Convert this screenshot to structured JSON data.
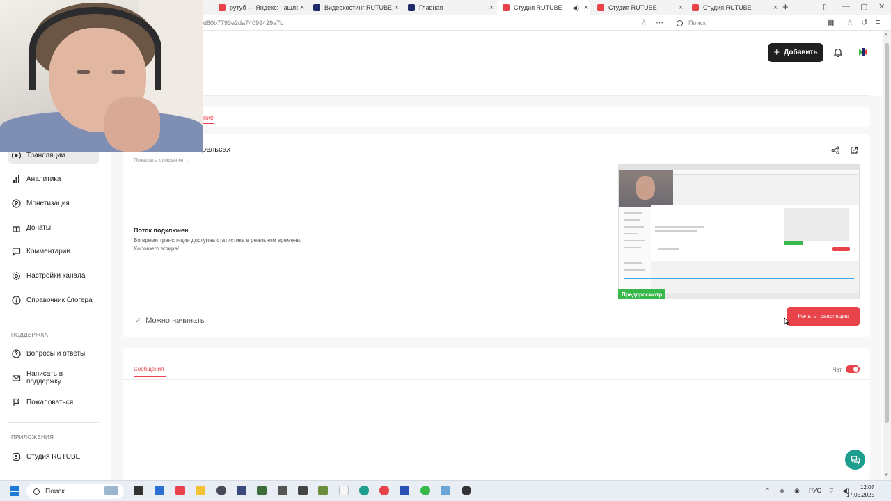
{
  "browser": {
    "tabs": [
      {
        "label": "рутуб — Яндекс: нашлос",
        "color": "#e8434a"
      },
      {
        "label": "Видеохостинг RUTUBE. Сі",
        "color": "#1f2a6b"
      },
      {
        "label": "Главная",
        "color": "#1f2a6b"
      },
      {
        "label": "Студия RUTUBE",
        "color": "#e8434a",
        "active": true
      },
      {
        "label": "Студия RUTUBE",
        "color": "#e8434a"
      },
      {
        "label": "Студия RUTUBE",
        "color": "#e8434a"
      }
    ],
    "url_fragment": "d80b7793e2da74099429a7b",
    "search_placeholder": "Поиск"
  },
  "header": {
    "add_label": "Добавить"
  },
  "sidebar": {
    "items": [
      {
        "label": "Трансляции",
        "icon": "broadcast-icon",
        "active": true
      },
      {
        "label": "Аналитика",
        "icon": "analytics-icon"
      },
      {
        "label": "Монетизация",
        "icon": "ruble-icon"
      },
      {
        "label": "Донаты",
        "icon": "donate-icon"
      },
      {
        "label": "Комментарии",
        "icon": "comment-icon"
      },
      {
        "label": "Настройки канала",
        "icon": "gear-icon"
      },
      {
        "label": "Справочник блогера",
        "icon": "info-icon"
      }
    ],
    "support_heading": "ПОДДЕРЖКА",
    "support_items": [
      {
        "label": "Вопросы и ответы",
        "icon": "help-icon"
      },
      {
        "label": "Написать в поддержку",
        "icon": "mail-icon"
      },
      {
        "label": "Пожаловаться",
        "icon": "flag-icon"
      }
    ],
    "apps_heading": "ПРИЛОЖЕНИЯ",
    "apps_items": [
      {
        "label": "Студия RUTUBE",
        "icon": "studio-icon"
      }
    ]
  },
  "main": {
    "tab_fragment": "ние",
    "stream_title_fragment": "рельсах",
    "show_description": "Показать описание",
    "status_title": "Поток подключен",
    "status_line1": "Во время трансляции доступна статистика в реальном времени.",
    "status_line2": "Хорошего эфира!",
    "ready_label": "Можно начинать",
    "preview_label": "Предпросмотр",
    "start_label": "Начать трансляцию",
    "messages_tab": "Сообщения",
    "chat_label": "Чат",
    "chat_enabled": true
  },
  "taskbar": {
    "search_label": "Поиск",
    "lang": "РУС",
    "time": "12:07",
    "date": "17.05.2025"
  },
  "colors": {
    "accent": "#e8434a",
    "preview_green": "#38b84a",
    "fab": "#1e9e8f"
  }
}
